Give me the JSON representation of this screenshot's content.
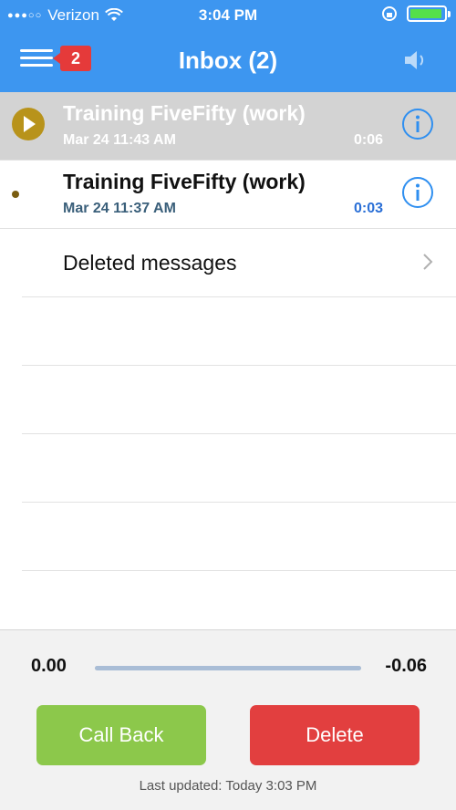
{
  "status_bar": {
    "carrier": "Verizon",
    "time": "3:04 PM"
  },
  "nav": {
    "badge_count": "2",
    "title": "Inbox (2)"
  },
  "messages": [
    {
      "name": "Training FiveFifty (work)",
      "date": "Mar 24 11:43 AM",
      "duration": "0:06",
      "state": "playing"
    },
    {
      "name": "Training FiveFifty (work)",
      "date": "Mar 24 11:37 AM",
      "duration": "0:03",
      "state": "unread"
    }
  ],
  "deleted": {
    "label": "Deleted messages"
  },
  "player": {
    "elapsed": "0.00",
    "remaining": "-0.06",
    "progress_fraction": 0.0
  },
  "actions": {
    "call_back": "Call Back",
    "delete": "Delete"
  },
  "footer": {
    "last_updated": "Last updated: Today 3:03 PM"
  },
  "colors": {
    "nav_bg": "#3d96f0",
    "call_back": "#8cc84b",
    "delete": "#e23f3f",
    "play": "#b8931b"
  }
}
